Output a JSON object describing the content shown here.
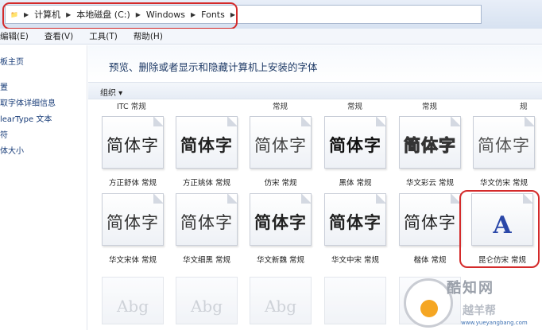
{
  "address": {
    "crumbs": [
      "计算机",
      "本地磁盘 (C:)",
      "Windows",
      "Fonts"
    ]
  },
  "menu": [
    "编辑(E)",
    "查看(V)",
    "工具(T)",
    "帮助(H)"
  ],
  "sidebar": {
    "items": [
      "板主页",
      "置",
      "取字体详细信息",
      "learType 文本",
      "符",
      "体大小"
    ]
  },
  "main": {
    "heading": "预览、删除或者显示和隐藏计算机上安装的字体",
    "organize_label": "组织 ▾",
    "top_labels": [
      "ITC 常规",
      "常规",
      "常规",
      "常规",
      "规"
    ],
    "row1": [
      {
        "sample": "简体字",
        "name": "方正舒体 常规"
      },
      {
        "sample": "简体字",
        "name": "方正姚体 常规"
      },
      {
        "sample": "简体字",
        "name": "仿宋 常规"
      },
      {
        "sample": "简体字",
        "name": "黑体 常规"
      },
      {
        "sample": "简体字",
        "name": "华文彩云 常规"
      },
      {
        "sample": "简体字",
        "name": "华文仿宋 常规"
      }
    ],
    "row2": [
      {
        "sample": "简体字",
        "name": "华文宋体 常规"
      },
      {
        "sample": "简体字",
        "name": "华文细黑 常规"
      },
      {
        "sample": "简体字",
        "name": "华文新魏 常规"
      },
      {
        "sample": "简体字",
        "name": "华文中宋 常规"
      },
      {
        "sample": "简体字",
        "name": "楷体 常规"
      },
      {
        "sample": "A",
        "name": "昆仑仿宋 常规"
      }
    ],
    "row3_samples": [
      "Abg",
      "Abg",
      "Abg"
    ]
  },
  "watermark": {
    "title": "酷知网",
    "subtitle": "越羊帮",
    "url": "www.yueyangbang.com"
  },
  "colors": {
    "highlight": "#d42a2a",
    "link": "#1b3f7a",
    "accent_letter": "#2a47a8"
  }
}
